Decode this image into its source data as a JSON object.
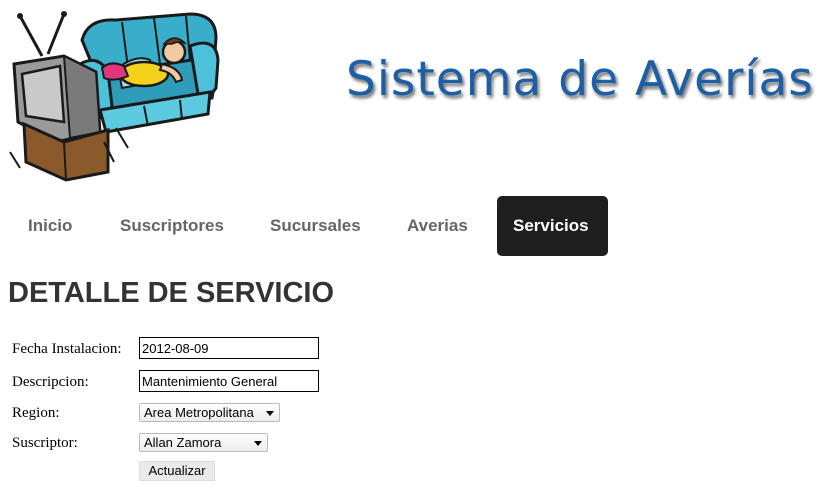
{
  "header": {
    "illustration_icon": "couch-potato-watching-tv-icon",
    "site_title": "Sistema de Averías",
    "title_color": "#1d5fa6"
  },
  "nav": {
    "items": [
      {
        "label": "Inicio",
        "active": false
      },
      {
        "label": "Suscriptores",
        "active": false
      },
      {
        "label": "Sucursales",
        "active": false
      },
      {
        "label": "Averias",
        "active": false
      },
      {
        "label": "Servicios",
        "active": true
      }
    ],
    "active_background": "#1e1e1e"
  },
  "page": {
    "heading": "DETALLE DE SERVICIO"
  },
  "form": {
    "fecha_label": "Fecha Instalacion:",
    "fecha_value": "2012-08-09",
    "descripcion_label": "Descripcion:",
    "descripcion_value": "Mantenimiento General",
    "region_label": "Region:",
    "region_selected": "Area Metropolitana",
    "suscriptor_label": "Suscriptor:",
    "suscriptor_selected": "Allan Zamora",
    "submit_label": "Actualizar"
  }
}
